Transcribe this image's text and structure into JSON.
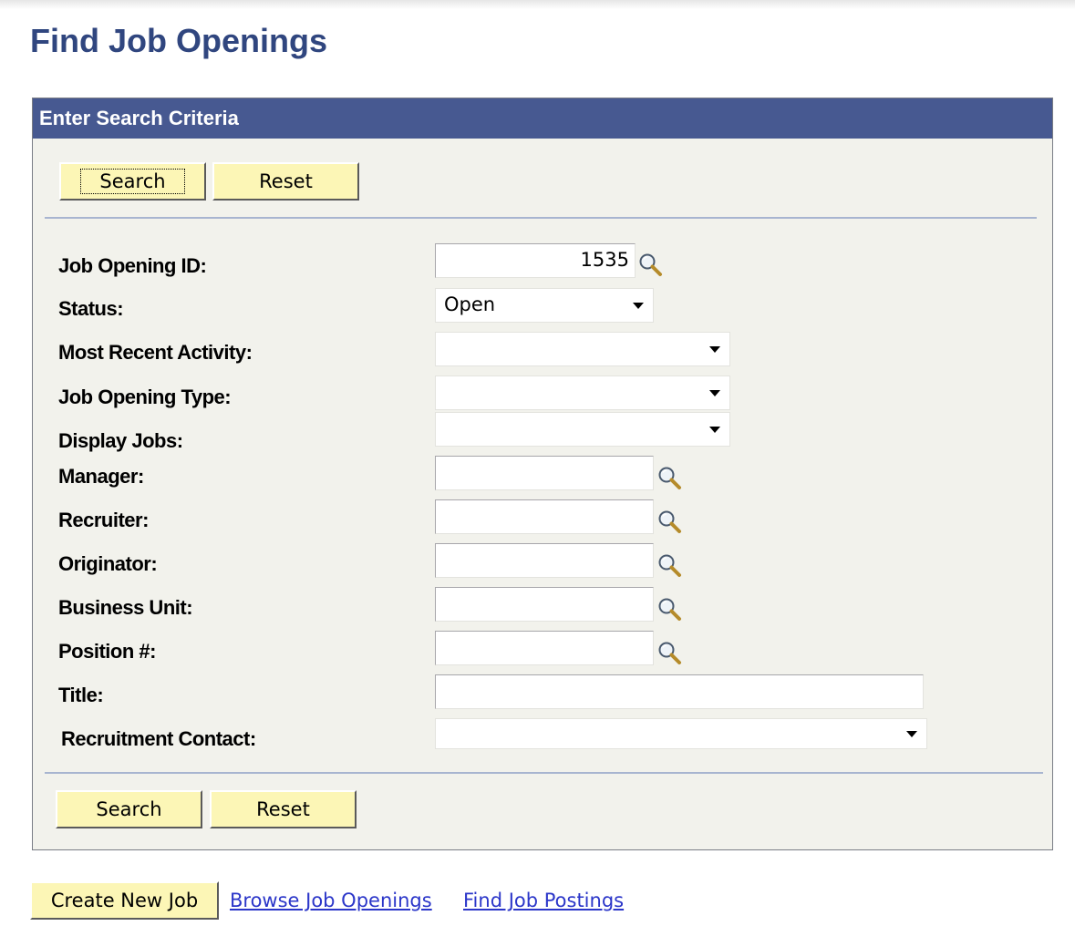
{
  "page": {
    "title": "Find Job Openings"
  },
  "criteria": {
    "header": "Enter Search Criteria",
    "search_label": "Search",
    "reset_label": "Reset",
    "fields": {
      "job_opening_id": {
        "label": "Job Opening ID:",
        "value": "1535"
      },
      "status": {
        "label": "Status:",
        "value": "Open"
      },
      "most_recent_activity": {
        "label": "Most Recent Activity:",
        "value": ""
      },
      "job_opening_type": {
        "label": "Job Opening Type:",
        "value": ""
      },
      "display_jobs": {
        "label": "Display Jobs:",
        "value": ""
      },
      "manager": {
        "label": "Manager:",
        "value": ""
      },
      "recruiter": {
        "label": "Recruiter:",
        "value": ""
      },
      "originator": {
        "label": "Originator:",
        "value": ""
      },
      "business_unit": {
        "label": "Business Unit:",
        "value": ""
      },
      "position": {
        "label": "Position #:",
        "value": ""
      },
      "title": {
        "label": "Title:",
        "value": ""
      },
      "recruitment_contact": {
        "label": "Recruitment Contact:",
        "value": ""
      }
    }
  },
  "footer": {
    "create_new_job_label": "Create New Job",
    "browse_link": "Browse Job Openings",
    "find_postings_link": "Find Job Postings"
  },
  "icons": {
    "lookup": "magnifying-glass-icon",
    "dropdown": "chevron-down-icon"
  },
  "colors": {
    "title": "#30467f",
    "header_bg": "#475991",
    "panel_bg": "#f2f2ec",
    "button_bg": "#fcf6b6",
    "link": "#2b36c9"
  }
}
